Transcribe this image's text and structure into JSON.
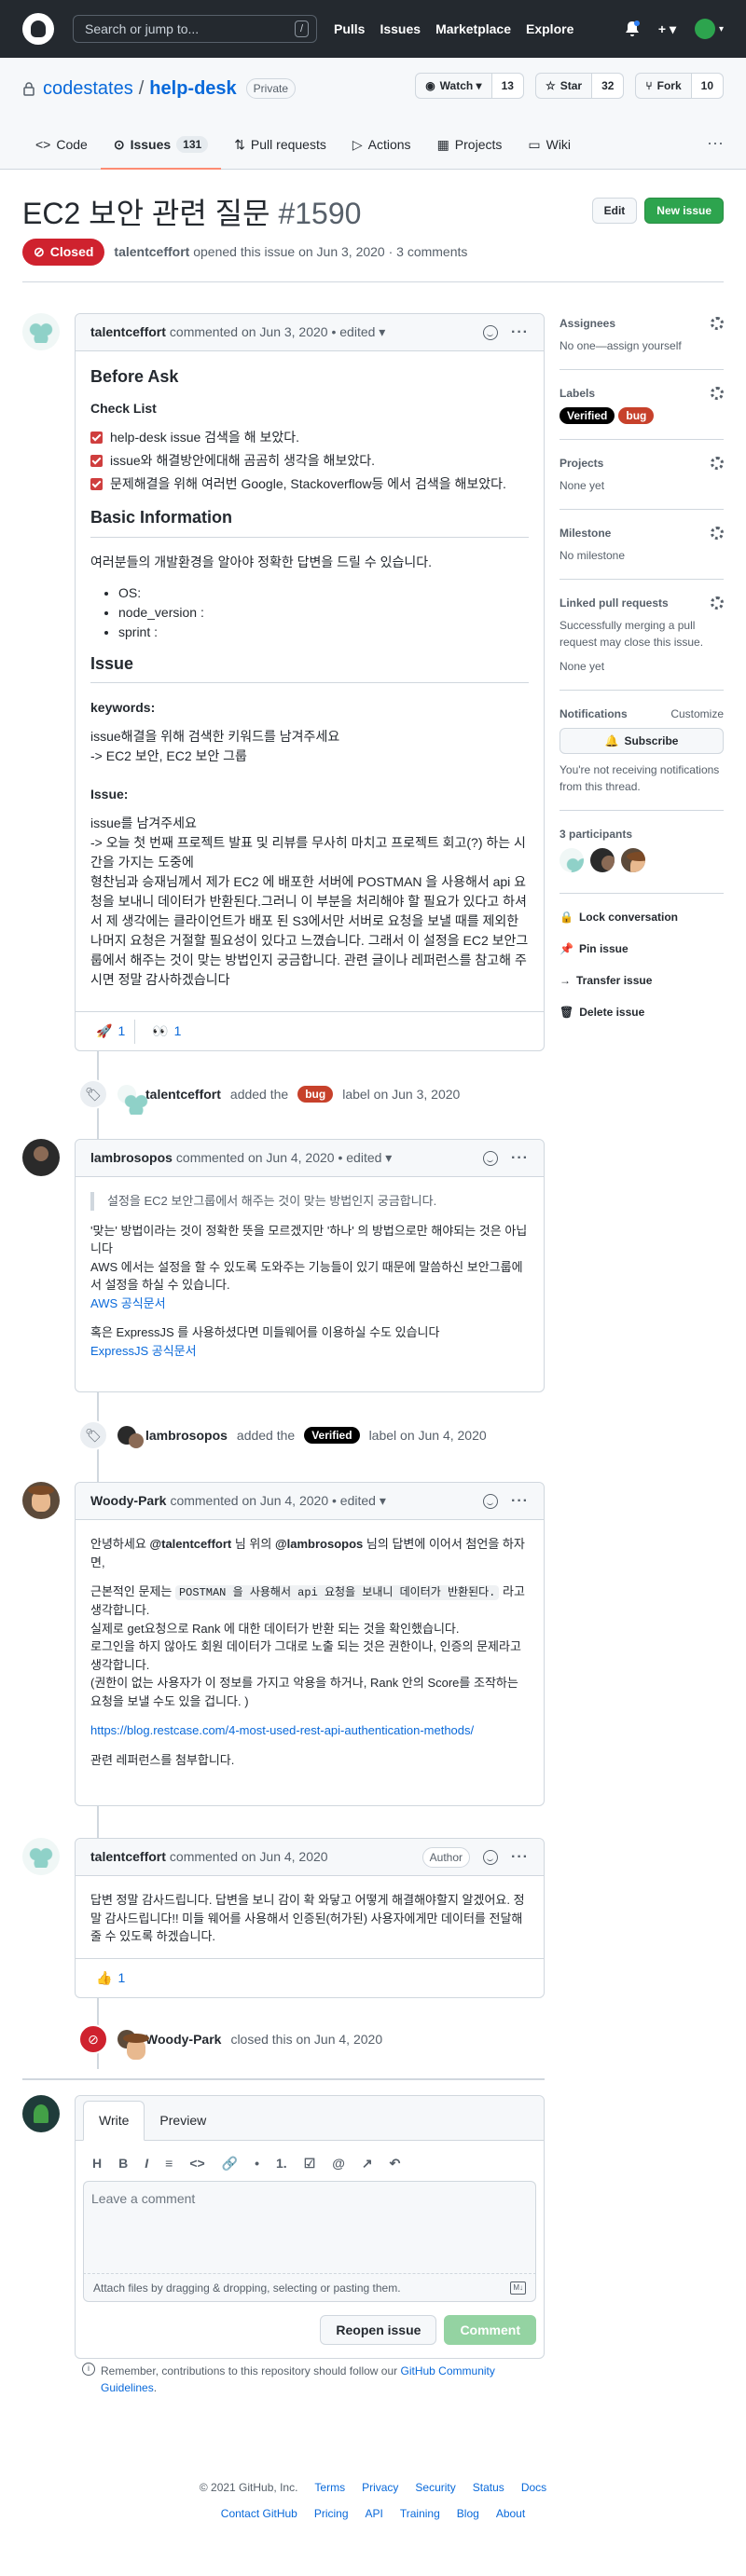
{
  "header": {
    "search_placeholder": "Search or jump to...",
    "search_key": "/",
    "nav": [
      "Pulls",
      "Issues",
      "Marketplace",
      "Explore"
    ],
    "plus": "+ ▾"
  },
  "repo": {
    "owner": "codestates",
    "sep": "/",
    "name": "help-desk",
    "visibility": "Private",
    "watch_label": "Watch ▾",
    "watch_count": "13",
    "star_label": "Star",
    "star_count": "32",
    "fork_label": "Fork",
    "fork_count": "10",
    "tabs": [
      {
        "label": "Code"
      },
      {
        "label": "Issues",
        "count": "131"
      },
      {
        "label": "Pull requests"
      },
      {
        "label": "Actions"
      },
      {
        "label": "Projects"
      },
      {
        "label": "Wiki"
      }
    ],
    "more": "···"
  },
  "issue": {
    "title": "EC2 보안 관련 질문",
    "number": "#1590",
    "edit_label": "Edit",
    "new_issue_label": "New issue",
    "state": "Closed",
    "author": "talentceffort",
    "meta": "opened this issue on Jun 3, 2020 · 3 comments"
  },
  "comments": [
    {
      "author": "talentceffort",
      "meta": "commented on Jun 3, 2020 • edited ▾",
      "before_ask": "Before Ask",
      "check_list": "Check List",
      "checks": [
        "help-desk issue 검색을 해 보았다.",
        "issue와 해결방안에대해 곰곰히 생각을 해보았다.",
        "문제해결을 위해 여러번 Google, Stackoverflow등 에서 검색을 해보았다."
      ],
      "basic_info": "Basic Information",
      "basic_desc": "여러분들의 개발환경을 알아야 정확한 답변을 드릴 수 있습니다.",
      "env": [
        "OS:",
        "node_version :",
        "sprint :"
      ],
      "issue_h": "Issue",
      "keywords_h": "keywords:",
      "keywords_1": "issue해결을 위해 검색한 키워드를 남겨주세요",
      "keywords_2": "-> EC2 보안, EC2 보안 그룹",
      "issue_label": "Issue:",
      "issue_1": "issue를 남겨주세요",
      "issue_2": "-> 오늘 첫 번째 프로젝트 발표 및 리뷰를 무사히 마치고 프로젝트 회고(?) 하는 시간을 가지는 도중에",
      "issue_3": "형찬님과 승재님께서 제가 EC2 에 배포한 서버에 POSTMAN 을 사용해서 api 요청을 보내니 데이터가 반환된다.그러니 이 부분을 처리해야 할 필요가 있다고 하셔서 제 생각에는 클라이언트가 배포 된 S3에서만 서버로 요청을 보낼 때를 제외한 나머지 요청은 거절할 필요성이 있다고 느꼈습니다. 그래서 이 설정을 EC2 보안그룹에서 해주는 것이 맞는 방법인지 궁금합니다. 관련 글이나 레퍼런스를 참고해 주시면 정말 감사하겠습니다",
      "reactions": [
        {
          "emoji": "🚀",
          "count": "1"
        },
        {
          "emoji": "👀",
          "count": "1"
        }
      ]
    },
    {
      "author": "lambrosopos",
      "meta": "commented on Jun 4, 2020 • edited ▾",
      "quote": "설정을 EC2 보안그룹에서 해주는 것이 맞는 방법인지 궁금합니다.",
      "p1": "'맞는' 방법이라는 것이 정확한 뜻을 모르겠지만 '하나' 의 방법으로만 해야되는 것은 아닙니다",
      "p2": "AWS 에서는 설정을 할 수 있도록 도와주는 기능들이 있기 때문에 말씀하신 보안그룹에서 설정을 하실 수 있습니다.",
      "link1": "AWS 공식문서",
      "p3": "혹은 ExpressJS 를 사용하셨다면 미들웨어를 이용하실 수도 있습니다",
      "link2": "ExpressJS 공식문서"
    },
    {
      "author": "Woody-Park",
      "meta": "commented on Jun 4, 2020 • edited ▾",
      "p1_a": "안녕하세요",
      "p1_m1": "@talentceffort",
      "p1_b": "님 위의",
      "p1_m2": "@lambrosopos",
      "p1_c": "님의 답변에 이어서 첨언을 하자면,",
      "p2_a": "근본적인 문제는",
      "p2_code": "POSTMAN 을 사용해서 api 요청을 보내니 데이터가 반환된다.",
      "p2_b": "라고 생각합니다.",
      "p3": "실제로 get요청으로 Rank 에 대한 데이터가 반환 되는 것을 확인했습니다.",
      "p4": "로그인을 하지 않아도 회원 데이터가 그대로 노출 되는 것은 권한이나, 인증의 문제라고 생각합니다.",
      "p5": "(권한이 없는 사용자가 이 정보를 가지고 악용을 하거나, Rank 안의 Score를 조작하는 요청을 보낼 수도 있을 겁니다. )",
      "link": "https://blog.restcase.com/4-most-used-rest-api-authentication-methods/",
      "p6": "관련 레퍼런스를 첨부합니다."
    },
    {
      "author": "talentceffort",
      "meta": "commented on Jun 4, 2020",
      "role": "Author",
      "body": "답변 정말 감사드립니다. 답변을 보니 감이 확 와닿고 어떻게 해결해야할지 알겠어요. 정말 감사드립니다!! 미들 웨어를 사용해서 인증된(허가된) 사용자에게만 데이터를 전달해 줄 수 있도록 하겠습니다.",
      "reactions": [
        {
          "emoji": "👍",
          "count": "1"
        }
      ]
    }
  ],
  "events": [
    {
      "actor": "talentceffort",
      "a": "added the",
      "label": "bug",
      "b": "label on Jun 3, 2020"
    },
    {
      "actor": "lambrosopos",
      "a": "added the",
      "label": "Verified",
      "b": "label on Jun 4, 2020"
    },
    {
      "actor": "Woody-Park",
      "a": "closed this on Jun 4, 2020"
    }
  ],
  "sidebar": {
    "assignees_h": "Assignees",
    "assignees_t": "No one—assign yourself",
    "labels_h": "Labels",
    "labels": [
      "Verified",
      "bug"
    ],
    "projects_h": "Projects",
    "projects_t": "None yet",
    "milestone_h": "Milestone",
    "milestone_t": "No milestone",
    "linked_h": "Linked pull requests",
    "linked_t": "Successfully merging a pull request may close this issue.",
    "linked_t2": "None yet",
    "notif_h": "Notifications",
    "notif_customize": "Customize",
    "subscribe": "Subscribe",
    "notif_t": "You're not receiving notifications from this thread.",
    "participants_h": "3 participants",
    "lock": "Lock conversation",
    "pin": "Pin issue",
    "transfer": "Transfer issue",
    "delete": "Delete issue"
  },
  "new_comment": {
    "tab_write": "Write",
    "tab_preview": "Preview",
    "toolbar": [
      "H",
      "B",
      "I",
      "≡",
      "<>",
      "🔗",
      "•",
      "1.",
      "☑",
      "@",
      "↗",
      "↶"
    ],
    "placeholder": "Leave a comment",
    "attach": "Attach files by dragging & dropping, selecting or pasting them.",
    "reopen": "Reopen issue",
    "comment": "Comment",
    "remember_a": "Remember, contributions to this repository should follow our",
    "remember_link": "GitHub Community Guidelines",
    "remember_b": "."
  },
  "footer": {
    "copyright": "© 2021 GitHub, Inc.",
    "row1": [
      "Terms",
      "Privacy",
      "Security",
      "Status",
      "Docs"
    ],
    "row2": [
      "Contact GitHub",
      "Pricing",
      "API",
      "Training",
      "Blog",
      "About"
    ]
  }
}
